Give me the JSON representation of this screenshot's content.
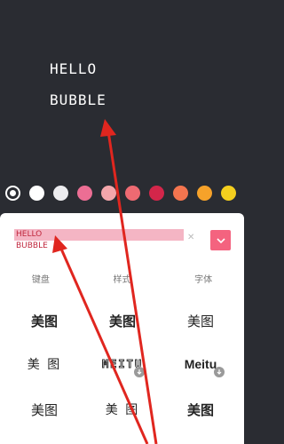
{
  "preview": {
    "line1": "HELLO",
    "line2": "BUBBLE"
  },
  "palette": {
    "colors": [
      "#2a2c32",
      "#ffffff",
      "#ececef",
      "#ec6e94",
      "#f4a6ab",
      "#ee6a72",
      "#d3264a",
      "#f4754f",
      "#f6a22a",
      "#f4cf1e"
    ],
    "selected_index": 0
  },
  "input": {
    "line1": "HELLO",
    "line2": "BUBBLE"
  },
  "tabs": [
    "键盘",
    "样式",
    "字体"
  ],
  "fonts": {
    "r1c1": "美图",
    "r1c2": "美图",
    "r1c3": "美图",
    "r2c1": "美 图",
    "r2c2": "MEITU",
    "r2c3": "Meitu",
    "r3c1": "美图",
    "r3c2": "美 图",
    "r3c3": "美图"
  },
  "accent": "#f4637f",
  "annotation_arrow_color": "#e0261f"
}
